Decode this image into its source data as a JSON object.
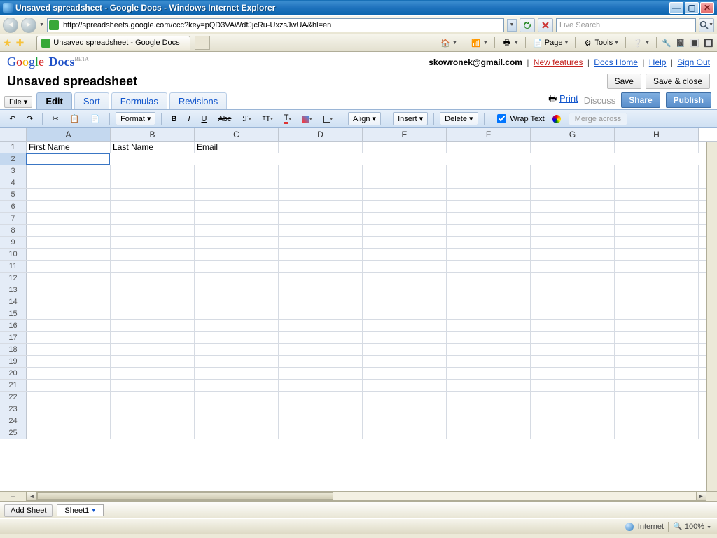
{
  "window": {
    "title": "Unsaved spreadsheet - Google Docs - Windows Internet Explorer"
  },
  "browser": {
    "url": "http://spreadsheets.google.com/ccc?key=pQD3VAWdfJjcRu-UxzsJwUA&hl=en",
    "search_placeholder": "Live Search",
    "tab_label": "Unsaved spreadsheet - Google Docs",
    "cmd_page": "Page",
    "cmd_tools": "Tools"
  },
  "account": {
    "email": "skowronek@gmail.com",
    "links": {
      "new_features": "New features",
      "docs_home": "Docs Home",
      "help": "Help",
      "sign_out": "Sign Out"
    }
  },
  "doc": {
    "title": "Unsaved spreadsheet",
    "save": "Save",
    "save_close": "Save & close"
  },
  "file_menu": "File ▾",
  "tabs": {
    "edit": "Edit",
    "sort": "Sort",
    "formulas": "Formulas",
    "revisions": "Revisions",
    "print": "Print",
    "discuss": "Discuss",
    "share": "Share",
    "publish": "Publish"
  },
  "toolbar": {
    "format": "Format ▾",
    "align": "Align ▾",
    "insert": "Insert ▾",
    "delete": "Delete ▾",
    "wrap": "Wrap Text",
    "merge": "Merge across"
  },
  "sheet": {
    "columns": [
      "A",
      "B",
      "C",
      "D",
      "E",
      "F",
      "G",
      "H"
    ],
    "rows": 25,
    "data": {
      "1": {
        "A": "First Name",
        "B": "Last Name",
        "C": "Email"
      }
    },
    "selected": {
      "row": 2,
      "col": "A"
    }
  },
  "sheetbar": {
    "add": "Add Sheet",
    "sheet1": "Sheet1"
  },
  "status": {
    "zone": "Internet",
    "zoom": "100%"
  },
  "logo": {
    "g": "G",
    "o1": "o",
    "o2": "o",
    "g2": "g",
    "l": "l",
    "e": "e",
    "docs": "Docs",
    "beta": "BETA"
  }
}
